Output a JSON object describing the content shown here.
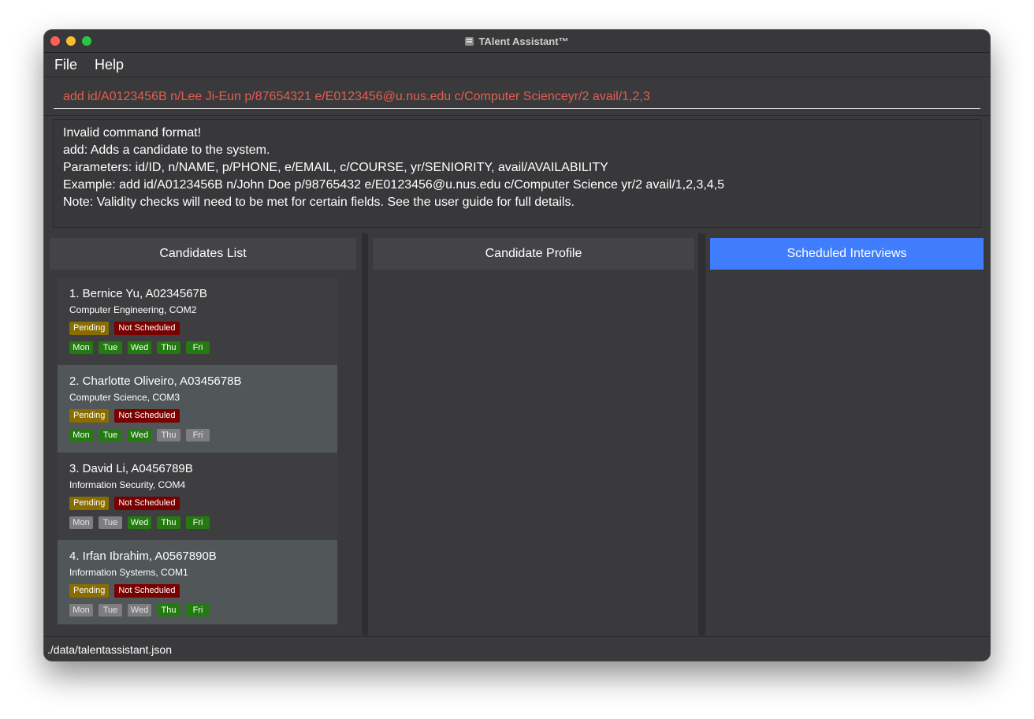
{
  "window": {
    "title": "TAlent Assistant™"
  },
  "menu": {
    "file": "File",
    "help": "Help"
  },
  "command": {
    "value": "add id/A0123456B n/Lee Ji-Eun p/87654321 e/E0123456@u.nus.edu c/Computer Scienceyr/2 avail/1,2,3"
  },
  "result": {
    "lines": [
      "Invalid command format!",
      "add: Adds a candidate to the system.",
      "Parameters: id/ID, n/NAME, p/PHONE, e/EMAIL, c/COURSE, yr/SENIORITY, avail/AVAILABILITY",
      "Example: add id/A0123456B n/John Doe p/98765432 e/E0123456@u.nus.edu c/Computer Science yr/2 avail/1,2,3,4,5",
      "Note: Validity checks will need to be met for certain fields. See the user guide for full details."
    ]
  },
  "panels": {
    "candidates_title": "Candidates List",
    "profile_title": "Candidate Profile",
    "interviews_title": "Scheduled Interviews"
  },
  "candidates": [
    {
      "name": "1.  Bernice Yu, A0234567B",
      "course": "Computer Engineering, COM2",
      "status": "Pending",
      "schedule": "Not Scheduled",
      "days": [
        {
          "label": "Mon",
          "available": true
        },
        {
          "label": "Tue",
          "available": true
        },
        {
          "label": "Wed",
          "available": true
        },
        {
          "label": "Thu",
          "available": true
        },
        {
          "label": "Fri",
          "available": true
        }
      ]
    },
    {
      "name": "2.  Charlotte Oliveiro, A0345678B",
      "course": "Computer Science, COM3",
      "status": "Pending",
      "schedule": "Not Scheduled",
      "days": [
        {
          "label": "Mon",
          "available": true
        },
        {
          "label": "Tue",
          "available": true
        },
        {
          "label": "Wed",
          "available": true
        },
        {
          "label": "Thu",
          "available": false
        },
        {
          "label": "Fri",
          "available": false
        }
      ]
    },
    {
      "name": "3.  David Li, A0456789B",
      "course": "Information Security, COM4",
      "status": "Pending",
      "schedule": "Not Scheduled",
      "days": [
        {
          "label": "Mon",
          "available": false
        },
        {
          "label": "Tue",
          "available": false
        },
        {
          "label": "Wed",
          "available": true
        },
        {
          "label": "Thu",
          "available": true
        },
        {
          "label": "Fri",
          "available": true
        }
      ]
    },
    {
      "name": "4.  Irfan Ibrahim, A0567890B",
      "course": "Information Systems, COM1",
      "status": "Pending",
      "schedule": "Not Scheduled",
      "days": [
        {
          "label": "Mon",
          "available": false
        },
        {
          "label": "Tue",
          "available": false
        },
        {
          "label": "Wed",
          "available": false
        },
        {
          "label": "Thu",
          "available": true
        },
        {
          "label": "Fri",
          "available": true
        }
      ]
    }
  ],
  "status_bar": {
    "path": "./data/talentassistant.json"
  },
  "colors": {
    "accent": "#3f7dfd",
    "command_error": "#e35d4f",
    "pending": "#8a6d00",
    "not_scheduled": "#7a0000",
    "day_available": "#237a10",
    "day_unavailable": "#7e7e80"
  }
}
